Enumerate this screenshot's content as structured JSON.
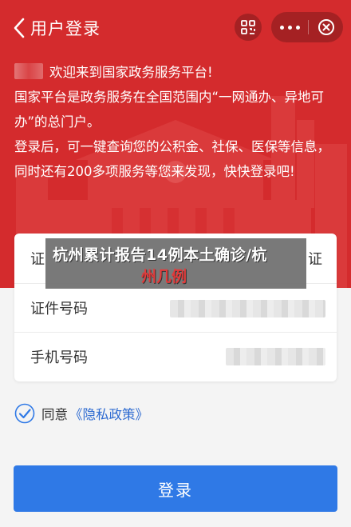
{
  "header": {
    "title": "用户登录",
    "back_icon": "chevron-left-icon",
    "scan_icon": "scan-icon",
    "more_icon": "more-dots-icon",
    "close_icon": "close-circle-icon"
  },
  "welcome": {
    "greeting": "欢迎来到国家政务服务平台!",
    "line1": "国家平台是政务服务在全国范围内“一网通办、异地可办”的总门户。",
    "line2": "登录后，可一键查询您的公积金、社保、医保等信息，同时还有200多项服务等您来发现，快快登录吧!"
  },
  "form": {
    "id_type_label": "证",
    "id_type_tail": "证",
    "id_number_label": "证件号码",
    "phone_label": "手机号码"
  },
  "news_overlay": {
    "line1": "杭州累计报告14例本土确诊/杭",
    "line2": "州几例"
  },
  "agreement": {
    "checked": true,
    "text": "同意",
    "link": "《隐私政策》"
  },
  "login_button": "登录",
  "colors": {
    "hero_red": "#d42b2d",
    "primary_blue": "#2f79e6",
    "link_blue": "#2e6bd1"
  }
}
